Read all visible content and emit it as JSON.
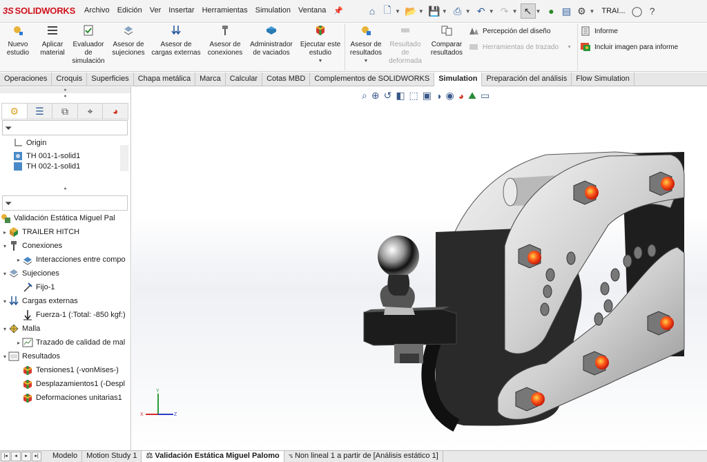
{
  "app": {
    "brand": "SOLIDWORKS",
    "brand_prefix": "3S"
  },
  "menu": [
    "Archivo",
    "Edición",
    "Ver",
    "Insertar",
    "Herramientas",
    "Simulation",
    "Ventana"
  ],
  "right": {
    "user": "TRAI..."
  },
  "ribbon": {
    "b1": [
      "Nuevo",
      "estudio"
    ],
    "b2": [
      "Aplicar",
      "material"
    ],
    "b3": [
      "Evaluador",
      "de",
      "simulación"
    ],
    "b4": [
      "Asesor de",
      "sujeciones"
    ],
    "b5": [
      "Asesor de",
      "cargas externas"
    ],
    "b6": [
      "Asesor de",
      "conexiones"
    ],
    "b7": [
      "Administrador",
      "de vaciados"
    ],
    "b8": [
      "Ejecutar este",
      "estudio"
    ],
    "b9": [
      "Asesor de",
      "resultados"
    ],
    "b10": [
      "Resultado",
      "de",
      "deformada"
    ],
    "b11": [
      "Comparar",
      "resultados"
    ],
    "s1": "Percepción del diseño",
    "s2": "Herramientas de trazado",
    "s3": "Informe",
    "s4": "Incluir imagen para informe"
  },
  "tabs": [
    "Operaciones",
    "Croquis",
    "Superficies",
    "Chapa metálica",
    "Marca",
    "Calcular",
    "Cotas MBD",
    "Complementos de SOLIDWORKS",
    "Simulation",
    "Preparación del análisis",
    "Flow Simulation"
  ],
  "tree1": [
    "Origin",
    "TH 001-1-solid1",
    "TH 002-1-solid1"
  ],
  "tree2": {
    "study": "Validación Estática Miguel Pal",
    "part": "TRAILER HITCH",
    "conexiones": "Conexiones",
    "interacciones": "Interacciones entre compo",
    "sujeciones": "Sujeciones",
    "fijo": "Fijo-1",
    "cargas": "Cargas externas",
    "fuerza": "Fuerza-1 (:Total: -850 kgf:)",
    "malla": "Malla",
    "trazado": "Trazado de calidad de mal",
    "resultados": "Resultados",
    "tensiones": "Tensiones1 (-vonMises-)",
    "desplaz": "Desplazamientos1 (-Despl",
    "deform": "Deformaciones unitarias1"
  },
  "triad": {
    "y": "Y",
    "x": "X",
    "z": "Z"
  },
  "bottom": [
    "Modelo",
    "Motion Study 1",
    "Validación Estática Miguel Palomo",
    "Non lineal 1 a partir de [Análisis estático 1]"
  ],
  "colors": {
    "brand": "#d0111b",
    "accent": "#2a5a9a"
  }
}
